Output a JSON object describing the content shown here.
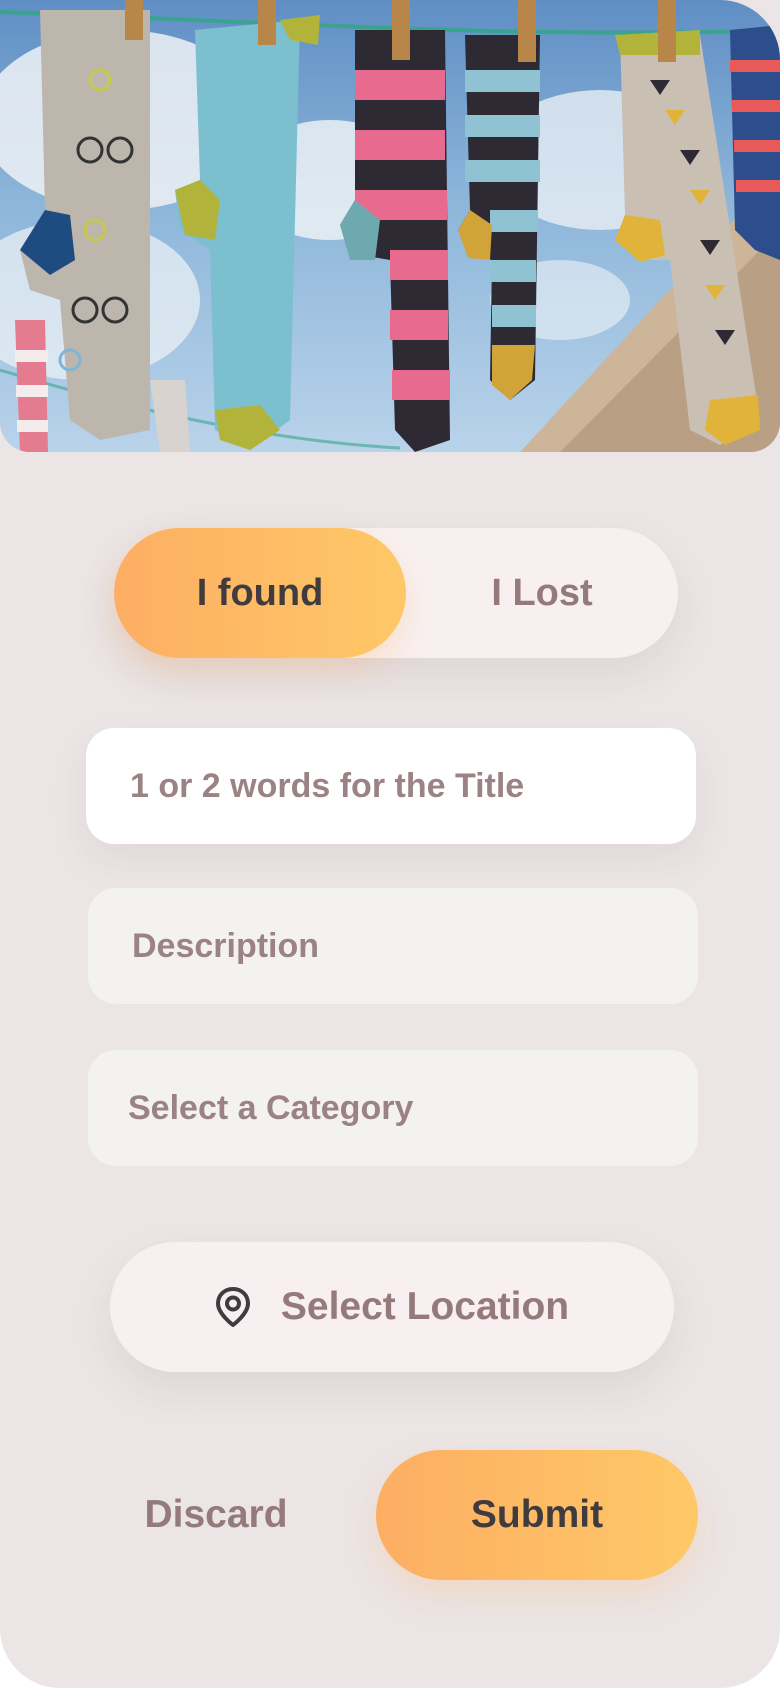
{
  "hero": {
    "image": "socks-on-clothesline-photo"
  },
  "post_type_toggle": {
    "selected": "I found",
    "options": [
      "I found",
      "I Lost"
    ]
  },
  "form": {
    "title_placeholder": "1 or 2 words for the Title",
    "title_value": "",
    "description_placeholder": "Description",
    "description_value": "",
    "category_placeholder": "Select a Category",
    "category_value": ""
  },
  "location": {
    "label": "Select Location",
    "icon": "location-pin-icon"
  },
  "actions": {
    "discard_label": "Discard",
    "submit_label": "Submit"
  },
  "colors": {
    "background": "#ebe5e5",
    "accent_gradient_start": "#fdae63",
    "accent_gradient_end": "#fec867",
    "muted_text": "#957a7c",
    "dark_text": "#3f3b3f",
    "pill_background": "#f8f0f0",
    "field_background": "#f4f2f1"
  }
}
